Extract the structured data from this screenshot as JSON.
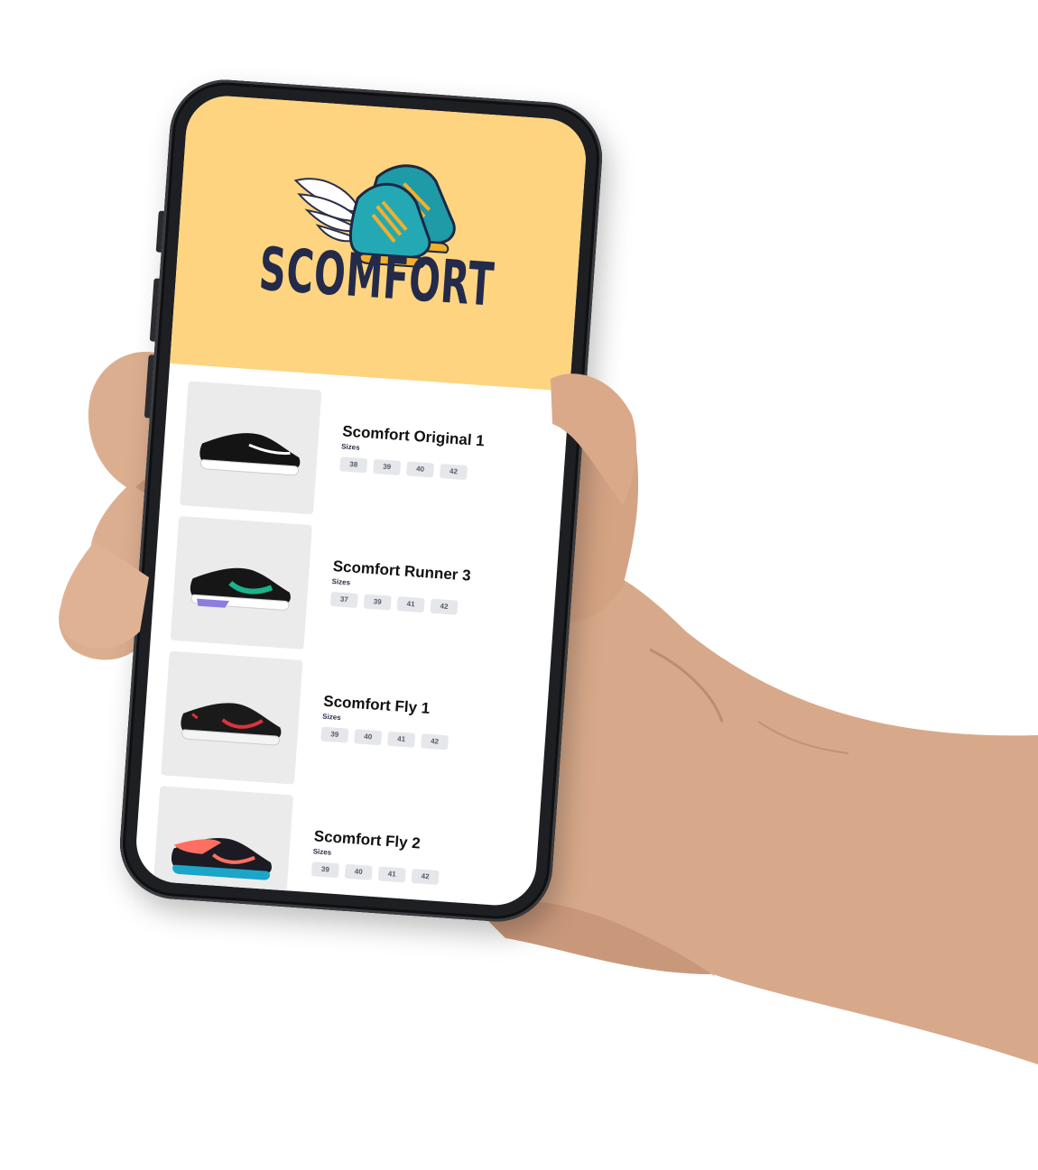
{
  "app": {
    "brand_title": "SCOMFORT",
    "header_color": "#ffd480",
    "brand_text_color": "#232a4a"
  },
  "products": [
    {
      "name": "Scomfort Original 1",
      "sizes_label": "Sizes",
      "sizes": [
        "38",
        "39",
        "40",
        "42"
      ],
      "shoe_colors": {
        "upper": "#141414",
        "sole": "#ffffff",
        "accent": "#ffffff",
        "swoosh": "#ffffff"
      }
    },
    {
      "name": "Scomfort Runner 3",
      "sizes_label": "Sizes",
      "sizes": [
        "37",
        "39",
        "41",
        "42"
      ],
      "shoe_colors": {
        "upper": "#161616",
        "sole": "#ffffff",
        "accent": "#8f7ce0",
        "swoosh": "#1bb38a"
      }
    },
    {
      "name": "Scomfort Fly 1",
      "sizes_label": "Sizes",
      "sizes": [
        "39",
        "40",
        "41",
        "42"
      ],
      "shoe_colors": {
        "upper": "#1a1a1a",
        "sole": "#f4f4f4",
        "accent": "#d8343c",
        "swoosh": "#d8343c"
      }
    },
    {
      "name": "Scomfort Fly 2",
      "sizes_label": "Sizes",
      "sizes": [
        "39",
        "40",
        "41",
        "42"
      ],
      "shoe_colors": {
        "upper": "#1c1a22",
        "sole": "#1aa5c9",
        "accent": "#ff6f61",
        "swoosh": "#ff6f61"
      }
    }
  ]
}
